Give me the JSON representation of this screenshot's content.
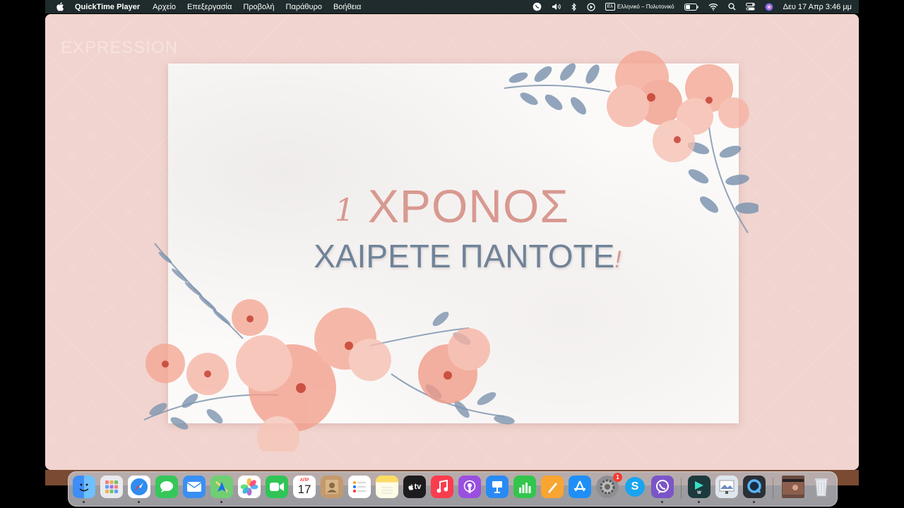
{
  "menubar": {
    "app_name": "QuickTime Player",
    "items": [
      "Αρχείο",
      "Επεξεργασία",
      "Προβολή",
      "Παράθυρο",
      "Βοήθεια"
    ],
    "keyboard_input": "Ελληνικό – Πολυτονικό",
    "keyboard_badge": "Ελ",
    "clock": "Δευ 17 Απρ  3:46 μμ"
  },
  "video": {
    "watermark": "EXPRESSION",
    "title_number": "1",
    "title_text": "ΧΡΟΝΟΣ",
    "subtitle_text": "ΧΑΙΡΕΤΕ ΠΑΝΤΟΤΕ",
    "subtitle_exclaim": "!"
  },
  "dock": {
    "calendar_month": "ΑΠΡ",
    "calendar_day": "17",
    "appletv_label": "tv",
    "settings_badge": "1",
    "skype_letter": "S",
    "apps": [
      {
        "name": "finder",
        "color": "#3e8ef7"
      },
      {
        "name": "launchpad",
        "color": "#e9e9ee"
      },
      {
        "name": "safari",
        "color": "#2f8cf0"
      },
      {
        "name": "messages",
        "color": "#35c759"
      },
      {
        "name": "mail",
        "color": "#3a8ff5"
      },
      {
        "name": "maps",
        "color": "#6fcf72"
      },
      {
        "name": "photos",
        "color": "#ffffff"
      },
      {
        "name": "facetime",
        "color": "#30c456"
      },
      {
        "name": "calendar",
        "color": "#ffffff"
      },
      {
        "name": "contacts",
        "color": "#c49a6c"
      },
      {
        "name": "reminders",
        "color": "#ffffff"
      },
      {
        "name": "notes",
        "color": "#fbdb64"
      },
      {
        "name": "appletv",
        "color": "#1c1c1e"
      },
      {
        "name": "music",
        "color": "#fb3c4e"
      },
      {
        "name": "podcasts",
        "color": "#9a4fe0"
      },
      {
        "name": "keynote",
        "color": "#2a8af5"
      },
      {
        "name": "numbers",
        "color": "#32c64c"
      },
      {
        "name": "pages",
        "color": "#f8a532"
      },
      {
        "name": "appstore",
        "color": "#1f8ff7"
      },
      {
        "name": "system-settings",
        "color": "#8e8e93"
      },
      {
        "name": "skype",
        "color": "#1aa4f0"
      },
      {
        "name": "viber",
        "color": "#7b55c8"
      },
      {
        "name": "filmora",
        "color": "#1c3a3e"
      },
      {
        "name": "preview",
        "color": "#dfe6ee"
      },
      {
        "name": "quicktime",
        "color": "#2b2f36"
      }
    ]
  }
}
